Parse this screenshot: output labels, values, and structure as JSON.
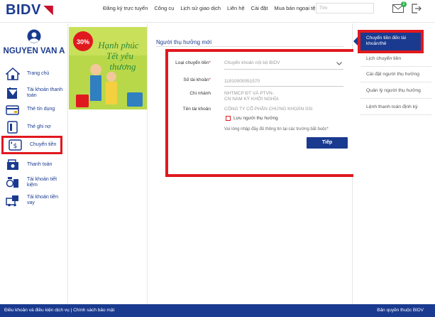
{
  "header": {
    "logo": "BIDV",
    "nav": [
      "Đăng ký trực tuyến",
      "Công cụ",
      "Lịch sử giao dịch",
      "Liên hệ",
      "Cài đặt",
      "Mua bán ngoại tệ"
    ],
    "search_placeholder": "Tìm",
    "notification_count": "2"
  },
  "sidebar": {
    "user_name": "NGUYEN VAN A",
    "items": [
      {
        "label": "Trang chủ",
        "icon": "home-icon"
      },
      {
        "label": "Tài khoản thanh toán",
        "icon": "account-icon"
      },
      {
        "label": "Thẻ tín dụng",
        "icon": "credit-card-icon"
      },
      {
        "label": "Thẻ ghi nợ",
        "icon": "debit-card-icon"
      },
      {
        "label": "Chuyển tiền",
        "icon": "transfer-icon"
      },
      {
        "label": "Thanh toán",
        "icon": "payment-icon"
      },
      {
        "label": "Tài khoản tiết kiệm",
        "icon": "savings-icon"
      },
      {
        "label": "Tài khoản tiền vay",
        "icon": "loan-icon"
      }
    ]
  },
  "banner": {
    "line1": "Hạnh phúc",
    "line2": "Tết yêu",
    "line3": "thương",
    "badge": "30%"
  },
  "main": {
    "title": "Người thụ hưởng mới",
    "form": {
      "transfer_type_label": "Loại chuyển tiền",
      "transfer_type_value": "Chuyển khoản nội bộ BIDV",
      "account_no_label": "Số tài khoản",
      "account_no_value": "11910000051570",
      "branch_label": "Chi nhánh",
      "branch_line1": "NHTMCP ĐT VÀ PTVN-",
      "branch_line2": "CN NAM KỲ KHỞI NGHĨA",
      "account_name_label": "Tên tài khoản",
      "account_name_value": "CÔNG TY CỔ PHẦN CHỨNG KHOÁN SSI",
      "save_beneficiary_label": "Lưu người thụ hưởng",
      "required_note": "Vui lòng nhập đầy đủ thông tin tại các trường bắt buộc*",
      "next_button": "Tiếp"
    }
  },
  "right_menu": {
    "active_line1": "Chuyển tiền đến tài",
    "active_line2": "khoản/thẻ",
    "items": [
      "Lịch chuyển tiền",
      "Cài đặt người thụ hưởng",
      "Quản lý người thụ hưởng",
      "Lệnh thanh toán định kỳ"
    ]
  },
  "footer": {
    "left": "Điều khoản và điều kiện dịch vụ | Chính sách bảo mật",
    "right": "Bản quyền thuộc BIDV"
  },
  "colors": {
    "brand_blue": "#1a3a8f",
    "highlight_red": "#e0191f",
    "banner_green": "#b8d84a"
  }
}
